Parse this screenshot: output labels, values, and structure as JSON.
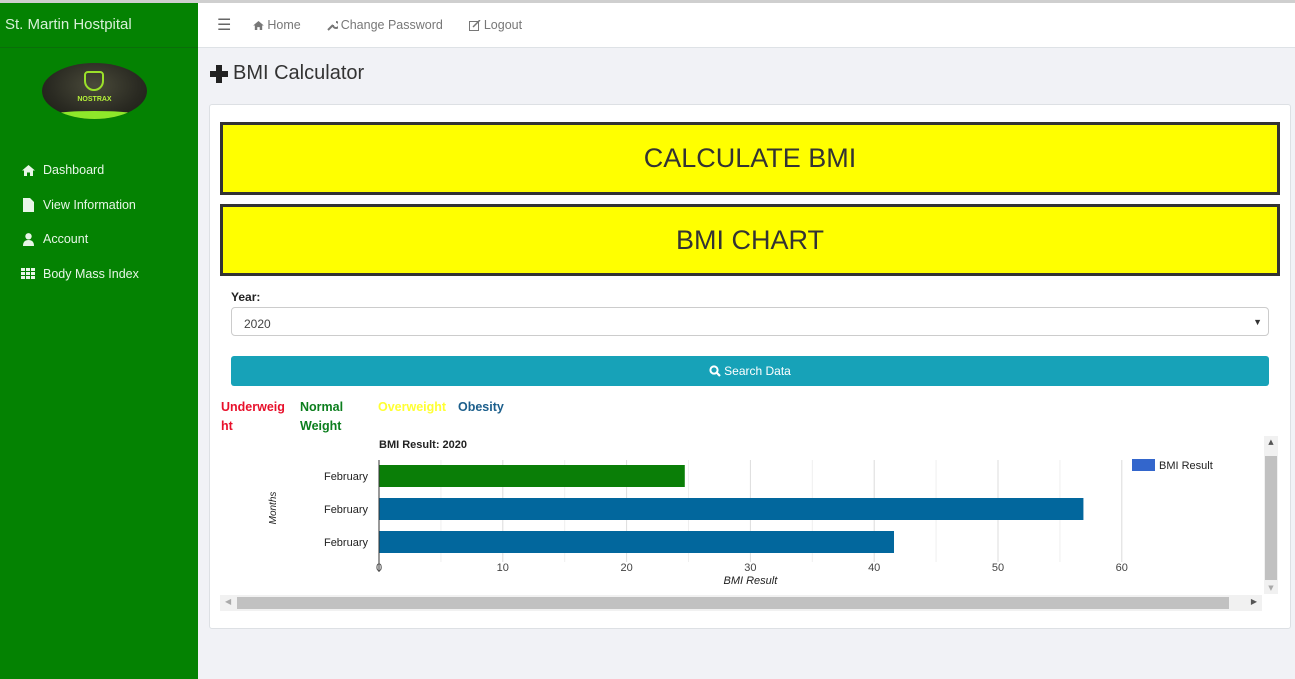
{
  "app": {
    "title": "St. Martin Hostpital",
    "logo_text": "NOSTRAX"
  },
  "sidebar": {
    "items": [
      {
        "label": "Dashboard",
        "icon": "home-icon"
      },
      {
        "label": "View Information",
        "icon": "file-icon"
      },
      {
        "label": "Account",
        "icon": "user-icon"
      },
      {
        "label": "Body Mass Index",
        "icon": "grid-icon"
      }
    ]
  },
  "topbar": {
    "links": [
      {
        "label": "Home",
        "icon": "home-icon"
      },
      {
        "label": "Change Password",
        "icon": "wrench-icon"
      },
      {
        "label": "Logout",
        "icon": "edit-icon"
      }
    ]
  },
  "page": {
    "title": "BMI Calculator"
  },
  "buttons": {
    "calculate": "CALCULATE BMI",
    "chart": "BMI CHART",
    "search": "Search Data"
  },
  "form": {
    "year_label": "Year:",
    "year_value": "2020"
  },
  "categories": [
    {
      "label": "Underweight",
      "color": "#e8102b"
    },
    {
      "label": "Normal Weight",
      "color": "#0b7e1d"
    },
    {
      "label": "Overweight",
      "color": "#ffff33"
    },
    {
      "label": "Obesity",
      "color": "#1c5f8c"
    }
  ],
  "colors": {
    "sidebar": "#048202",
    "accent": "#17a2b8",
    "highlight": "#ffff00"
  },
  "chart_data": {
    "type": "bar",
    "orientation": "horizontal",
    "title": "BMI Result: 2020",
    "xlabel": "BMI Result",
    "ylabel": "Months",
    "categories": [
      "February",
      "February",
      "February"
    ],
    "values": [
      24.7,
      56.9,
      41.6
    ],
    "bar_colors": [
      "#0a7e07",
      "#02679d",
      "#02679d"
    ],
    "xlim": [
      0,
      65
    ],
    "xticks": [
      0,
      10,
      20,
      30,
      40,
      50,
      60
    ],
    "grid": true,
    "legend": {
      "label": "BMI Result",
      "color": "#3366cc",
      "position": "top-right"
    }
  }
}
